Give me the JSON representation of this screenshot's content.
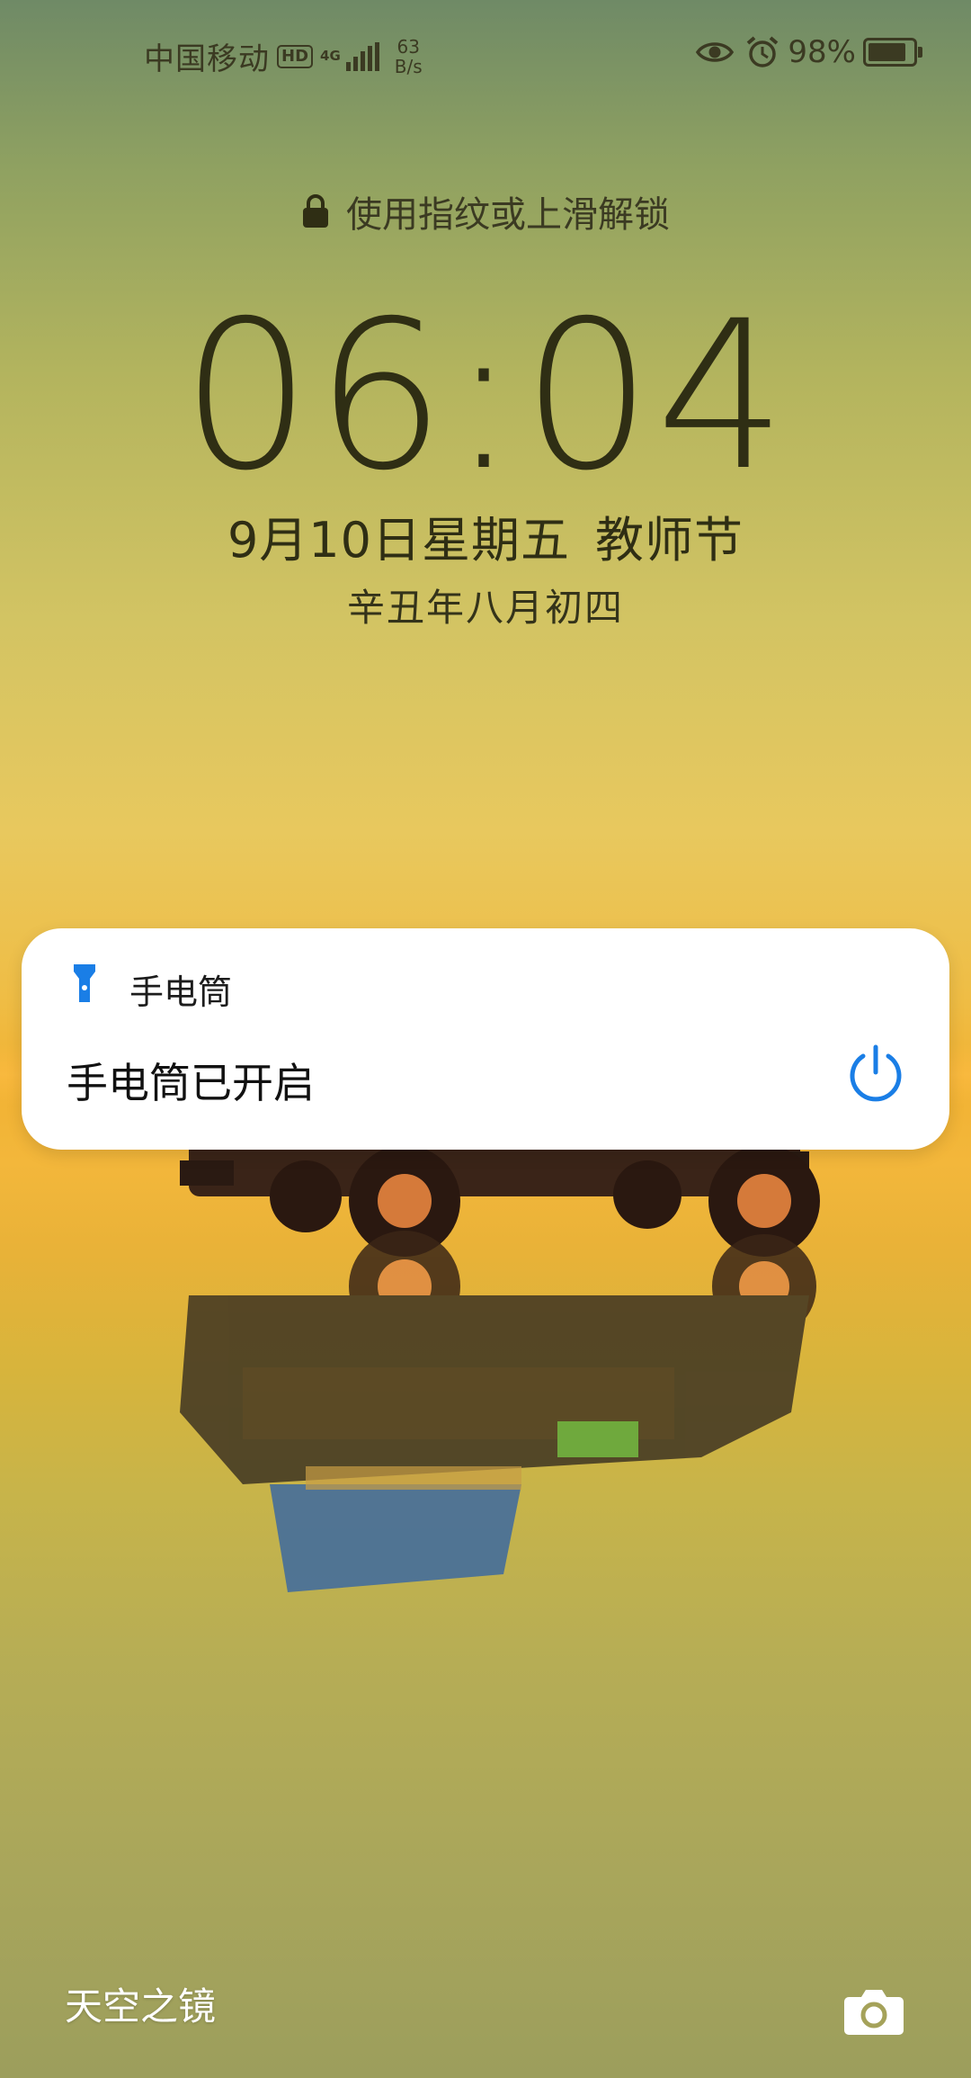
{
  "status_bar": {
    "carrier": "中国移动",
    "hd_badge": "HD",
    "network_type": "4G",
    "net_speed_value": "63",
    "net_speed_unit": "B/s",
    "battery_percent": "98%",
    "battery_level": 0.98,
    "icons": [
      "eye-icon",
      "alarm-icon",
      "battery-icon",
      "signal-icon"
    ]
  },
  "lockscreen": {
    "unlock_hint": "使用指纹或上滑解锁",
    "time": "06:04",
    "date": "9月10日星期五",
    "holiday": "教师节",
    "lunar_date": "辛丑年八月初四"
  },
  "notification": {
    "app_name": "手电筒",
    "title": "手电筒已开启",
    "app_icon": "flashlight-icon",
    "action_icon": "power-icon",
    "accent_color": "#1a7ee6"
  },
  "bottom": {
    "wallpaper_name": "天空之镜",
    "camera_icon": "camera-icon"
  }
}
